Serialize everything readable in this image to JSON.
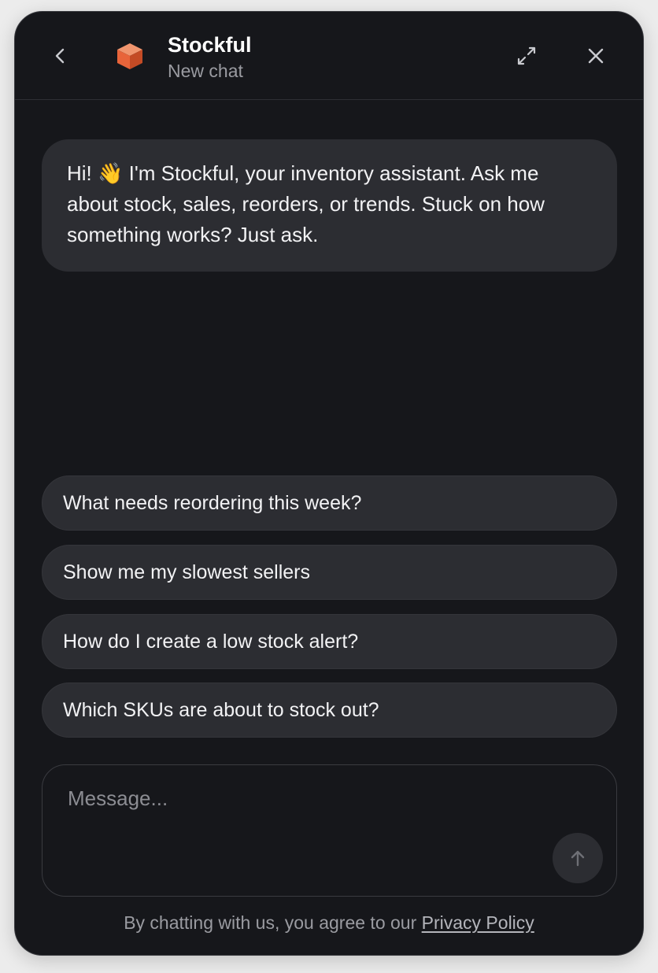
{
  "header": {
    "title": "Stockful",
    "subtitle": "New chat",
    "back_icon": "chevron-left-icon",
    "logo_icon": "cube-icon",
    "expand_icon": "expand-icon",
    "close_icon": "close-icon",
    "logo_color": "#e8643a"
  },
  "chat": {
    "greeting_before": "Hi! ",
    "greeting_emoji": "👋",
    "greeting_after": " I'm Stockful, your inventory assistant. Ask me about stock, sales, reorders, or trends. Stuck on how something works? Just ask."
  },
  "suggestions": [
    "What needs reordering this week?",
    "Show me my slowest sellers",
    "How do I create a low stock alert?",
    "Which SKUs are about to stock out?"
  ],
  "composer": {
    "placeholder": "Message...",
    "value": "",
    "send_icon": "arrow-up-icon"
  },
  "footer": {
    "text": "By chatting with us, you agree to our ",
    "link": "Privacy Policy"
  },
  "colors": {
    "background": "#16171b",
    "surface": "#2c2d32",
    "accent": "#e8643a"
  }
}
